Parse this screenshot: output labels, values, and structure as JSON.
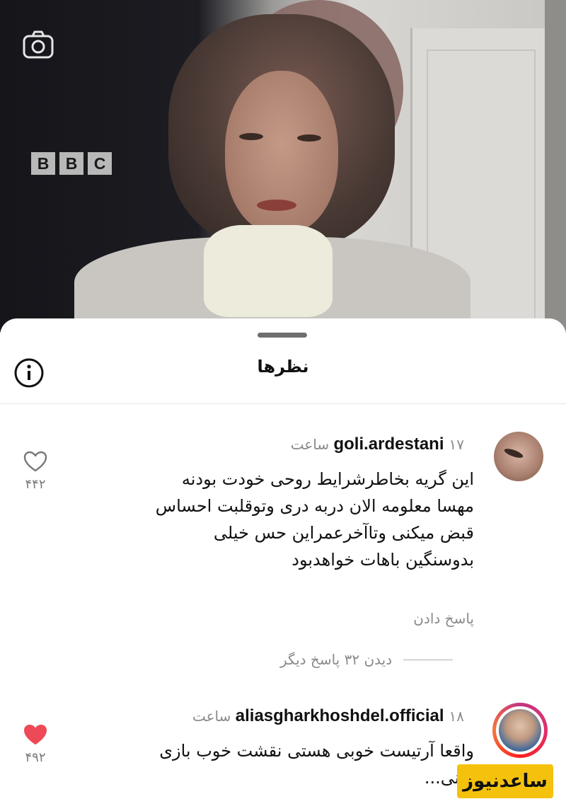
{
  "video": {
    "channel_logo": [
      "B",
      "B",
      "C"
    ],
    "icons": {
      "camera": "camera-icon"
    }
  },
  "sheet": {
    "title": "نظرها",
    "icons": {
      "info": "info-icon"
    }
  },
  "comments": [
    {
      "username": "goli.ardestani",
      "time": "۱۷ ساعت",
      "lines": [
        "این گریه بخاطرشرایط روحی خودت بودنه",
        "مهسا معلومه الان دربه دری وتوقلبت احساس",
        "قبض میکنی وتاآخرعمراین حس خیلی",
        "بدوسنگین باهات خواهدبود"
      ],
      "reply_label": "پاسخ دادن",
      "likes": "۴۴۲",
      "liked": false,
      "view_more": "دیدن ۳۲ پاسخ دیگر"
    },
    {
      "username": "aliasgharkhoshdel.official",
      "time": "۱۸ ساعت",
      "lines": [
        "واقعا آرتیست خوبی هستی نقشت خوب بازی",
        "بکنی..."
      ],
      "likes": "۴۹۲",
      "liked": true
    }
  ],
  "watermark": "ساعدنیوز",
  "colors": {
    "like_red": "#ed4956",
    "muted": "#8a8a8a",
    "watermark_bg": "#f4c20d"
  }
}
